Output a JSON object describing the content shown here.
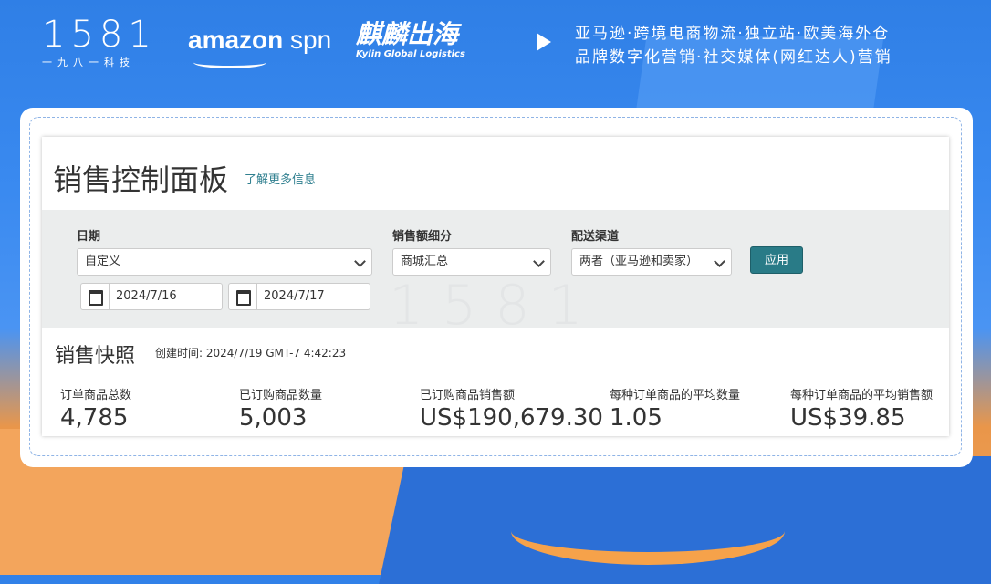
{
  "header": {
    "logo_number": "1581",
    "logo_sub": "一九八一科技",
    "amazon_bold": "amazon",
    "amazon_light": " spn",
    "kylin_cn": "麒麟出海",
    "kylin_en": "Kylin Global Logistics",
    "tagline1": "亚马逊·跨境电商物流·独立站·欧美海外仓",
    "tagline2": "品牌数字化营销·社交媒体(网红达人)营销"
  },
  "dashboard": {
    "title": "销售控制面板",
    "learn_more": "了解更多信息",
    "filters": {
      "date_label": "日期",
      "date_range_value": "自定义",
      "start_date": "2024/7/16",
      "end_date": "2024/7/17",
      "breakdown_label": "销售额细分",
      "breakdown_value": "商城汇总",
      "channel_label": "配送渠道",
      "channel_value": "两者（亚马逊和卖家）",
      "apply_label": "应用"
    },
    "watermark": "1581",
    "snapshot": {
      "title": "销售快照",
      "created_label": "创建时间: 2024/7/19 GMT-7 4:42:23",
      "metrics": [
        {
          "label": "订单商品总数",
          "value": "4,785"
        },
        {
          "label": "已订购商品数量",
          "value": "5,003"
        },
        {
          "label": "已订购商品销售额",
          "value": "US$190,679.30"
        },
        {
          "label": "每种订单商品的平均数量",
          "value": "1.05"
        },
        {
          "label": "每种订单商品的平均销售额",
          "value": "US$39.85"
        }
      ]
    }
  }
}
